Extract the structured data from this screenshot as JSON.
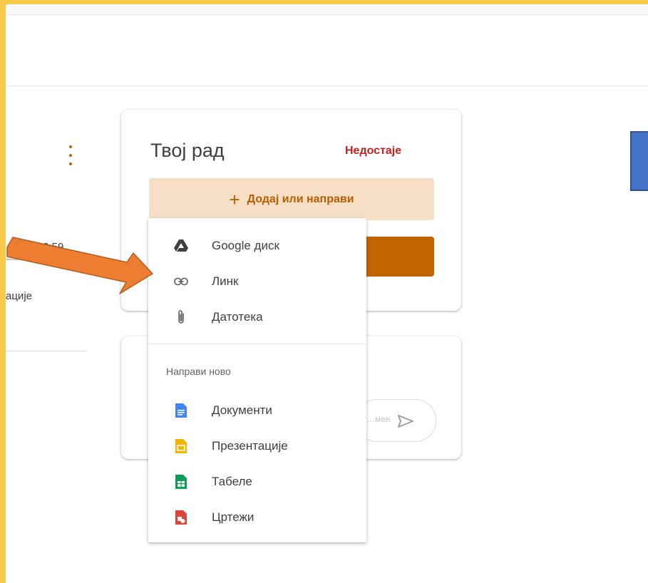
{
  "left_panel": {
    "due_text": "…нов 23:59",
    "attachment_fragment": "ације"
  },
  "work_card": {
    "title": "Твој рад",
    "status": "Недостаје",
    "add_button": {
      "icon": "plus-icon",
      "label": "Додај или направи"
    }
  },
  "comment_card": {
    "post_placeholder": "…мен"
  },
  "add_menu": {
    "items": [
      {
        "label": "Google диск",
        "icon": "google-drive-icon"
      },
      {
        "label": "Линк",
        "icon": "link-icon"
      },
      {
        "label": "Датотека",
        "icon": "paperclip-icon"
      }
    ],
    "create_new_heading": "Направи ново",
    "create_items": [
      {
        "label": "Документи",
        "icon": "google-docs-icon",
        "color": "#4285f4"
      },
      {
        "label": "Презентације",
        "icon": "google-slides-icon",
        "color": "#f4b400"
      },
      {
        "label": "Табеле",
        "icon": "google-sheets-icon",
        "color": "#0f9d58"
      },
      {
        "label": "Цртежи",
        "icon": "google-drawings-icon",
        "color": "#db4437"
      }
    ]
  },
  "colors": {
    "accent": "#c26401",
    "missing": "#c5221f",
    "frame": "#f7c948",
    "arrow": "#ed7d31"
  }
}
